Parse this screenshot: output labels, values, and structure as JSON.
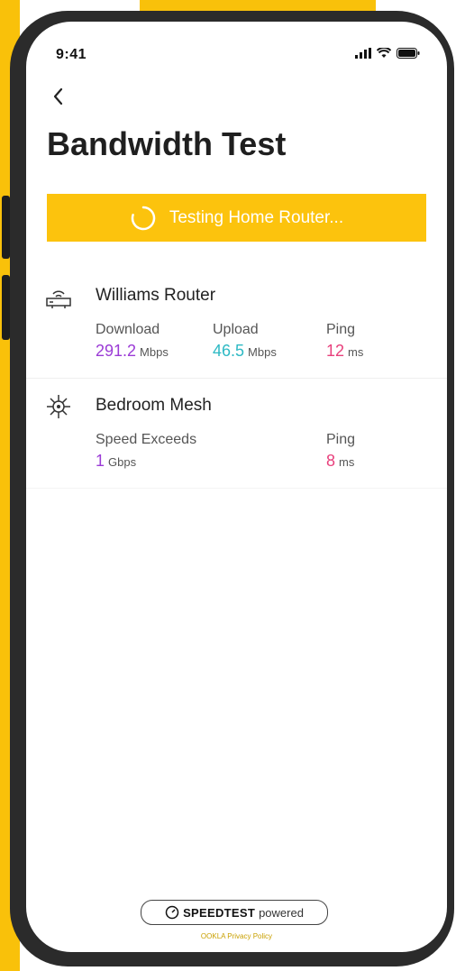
{
  "status_bar": {
    "time": "9:41"
  },
  "header": {
    "title": "Bandwidth Test"
  },
  "banner": {
    "label": "Testing Home Router..."
  },
  "devices": [
    {
      "name": "Williams Router",
      "icon": "router-icon",
      "metrics": [
        {
          "label": "Download",
          "value": "291.2",
          "unit": "Mbps",
          "color": "#9b3bd6"
        },
        {
          "label": "Upload",
          "value": "46.5",
          "unit": "Mbps",
          "color": "#2db9c4"
        },
        {
          "label": "Ping",
          "value": "12",
          "unit": "ms",
          "color": "#e8407c"
        }
      ]
    },
    {
      "name": "Bedroom Mesh",
      "icon": "mesh-node-icon",
      "metrics": [
        {
          "label": "Speed Exceeds",
          "value": "1",
          "unit": "Gbps",
          "color": "#9b3bd6"
        },
        {
          "label": "Ping",
          "value": "8",
          "unit": "ms",
          "color": "#e8407c"
        }
      ]
    }
  ],
  "footer": {
    "badge_strong": "SPEEDTEST",
    "badge_light": "powered",
    "privacy": "OOKLA Privacy Policy"
  },
  "colors": {
    "accent": "#fcc30d",
    "frame": "#2b2b2b"
  }
}
